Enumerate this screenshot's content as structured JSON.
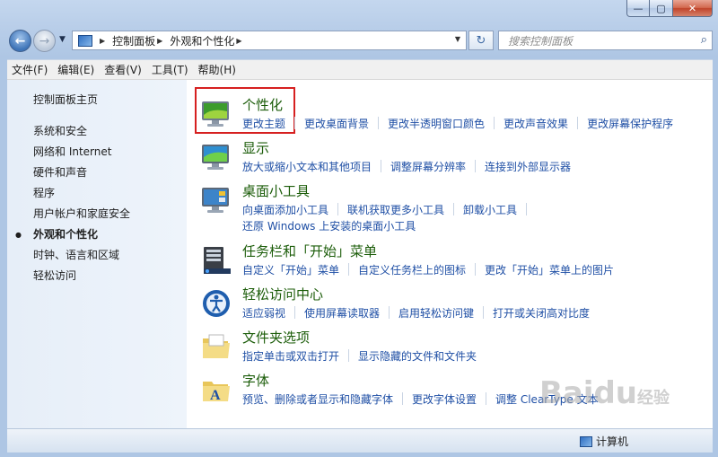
{
  "window": {
    "min_label": "—",
    "max_label": "▢",
    "close_label": "✕"
  },
  "nav": {
    "back_glyph": "←",
    "forward_glyph": "→",
    "breadcrumbs": [
      "控制面板",
      "外观和个性化"
    ],
    "refresh_glyph": "↻",
    "search_placeholder": "搜索控制面板"
  },
  "menu": [
    "文件(F)",
    "编辑(E)",
    "查看(V)",
    "工具(T)",
    "帮助(H)"
  ],
  "sidebar": {
    "home": "控制面板主页",
    "items": [
      {
        "label": "系统和安全",
        "active": false
      },
      {
        "label": "网络和 Internet",
        "active": false
      },
      {
        "label": "硬件和声音",
        "active": false
      },
      {
        "label": "程序",
        "active": false
      },
      {
        "label": "用户帐户和家庭安全",
        "active": false
      },
      {
        "label": "外观和个性化",
        "active": true
      },
      {
        "label": "时钟、语言和区域",
        "active": false
      },
      {
        "label": "轻松访问",
        "active": false
      }
    ]
  },
  "categories": [
    {
      "title": "个性化",
      "icon": "personalization-icon",
      "rows": [
        [
          "更改主题",
          "更改桌面背景",
          "更改半透明窗口颜色",
          "更改声音效果",
          "更改屏幕保护程序"
        ]
      ]
    },
    {
      "title": "显示",
      "icon": "display-icon",
      "rows": [
        [
          "放大或缩小文本和其他项目",
          "调整屏幕分辨率",
          "连接到外部显示器"
        ]
      ]
    },
    {
      "title": "桌面小工具",
      "icon": "gadgets-icon",
      "rows": [
        [
          "向桌面添加小工具",
          "联机获取更多小工具",
          "卸载小工具"
        ],
        [
          "还原 Windows 上安装的桌面小工具"
        ]
      ]
    },
    {
      "title": "任务栏和「开始」菜单",
      "icon": "taskbar-icon",
      "rows": [
        [
          "自定义「开始」菜单",
          "自定义任务栏上的图标",
          "更改「开始」菜单上的图片"
        ]
      ]
    },
    {
      "title": "轻松访问中心",
      "icon": "ease-of-access-icon",
      "rows": [
        [
          "适应弱视",
          "使用屏幕读取器",
          "启用轻松访问键",
          "打开或关闭高对比度"
        ]
      ]
    },
    {
      "title": "文件夹选项",
      "icon": "folder-options-icon",
      "rows": [
        [
          "指定单击或双击打开",
          "显示隐藏的文件和文件夹"
        ]
      ]
    },
    {
      "title": "字体",
      "icon": "fonts-icon",
      "rows": [
        [
          "预览、删除或者显示和隐藏字体",
          "更改字体设置",
          "调整 ClearType 文本"
        ]
      ]
    }
  ],
  "status": {
    "computer": "计算机"
  },
  "watermark": {
    "text": "Baidu",
    "sub": "经验"
  }
}
